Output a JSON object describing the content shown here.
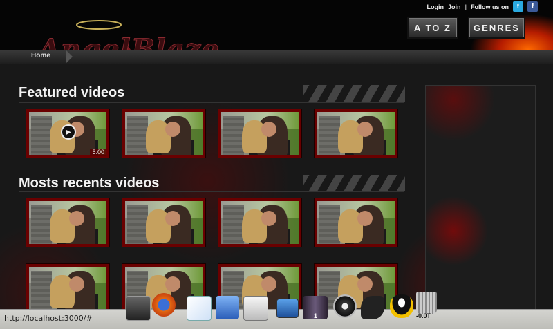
{
  "header": {
    "logo_text": "AngelBlaze",
    "links": {
      "login": "Login",
      "join": "Join",
      "separator": "|",
      "follow": "Follow us on"
    },
    "social": [
      {
        "name": "twitter-icon",
        "glyph": "t"
      },
      {
        "name": "facebook-icon",
        "glyph": "f"
      }
    ],
    "buttons": {
      "atoz": "A TO Z",
      "genres": "GENRES"
    }
  },
  "nav": {
    "home": "Home"
  },
  "sections": [
    {
      "title": "Featured videos",
      "duration": "5:00"
    },
    {
      "title": "Mosts recents videos"
    }
  ],
  "statusbar": {
    "url": "http://localhost:3000/#"
  },
  "dock": {
    "workspace_label": "1",
    "trash_label": "-0.0T",
    "items": [
      "terminal-icon",
      "firefox-icon",
      "text-editor-icon",
      "finder-icon",
      "documents-icon",
      "desktop-icon",
      "workspace-icon",
      "media-icon",
      "dragon-icon",
      "linux-penguin-icon",
      "trash-icon"
    ]
  },
  "colors": {
    "accent": "#8b0000",
    "background": "#181818"
  }
}
